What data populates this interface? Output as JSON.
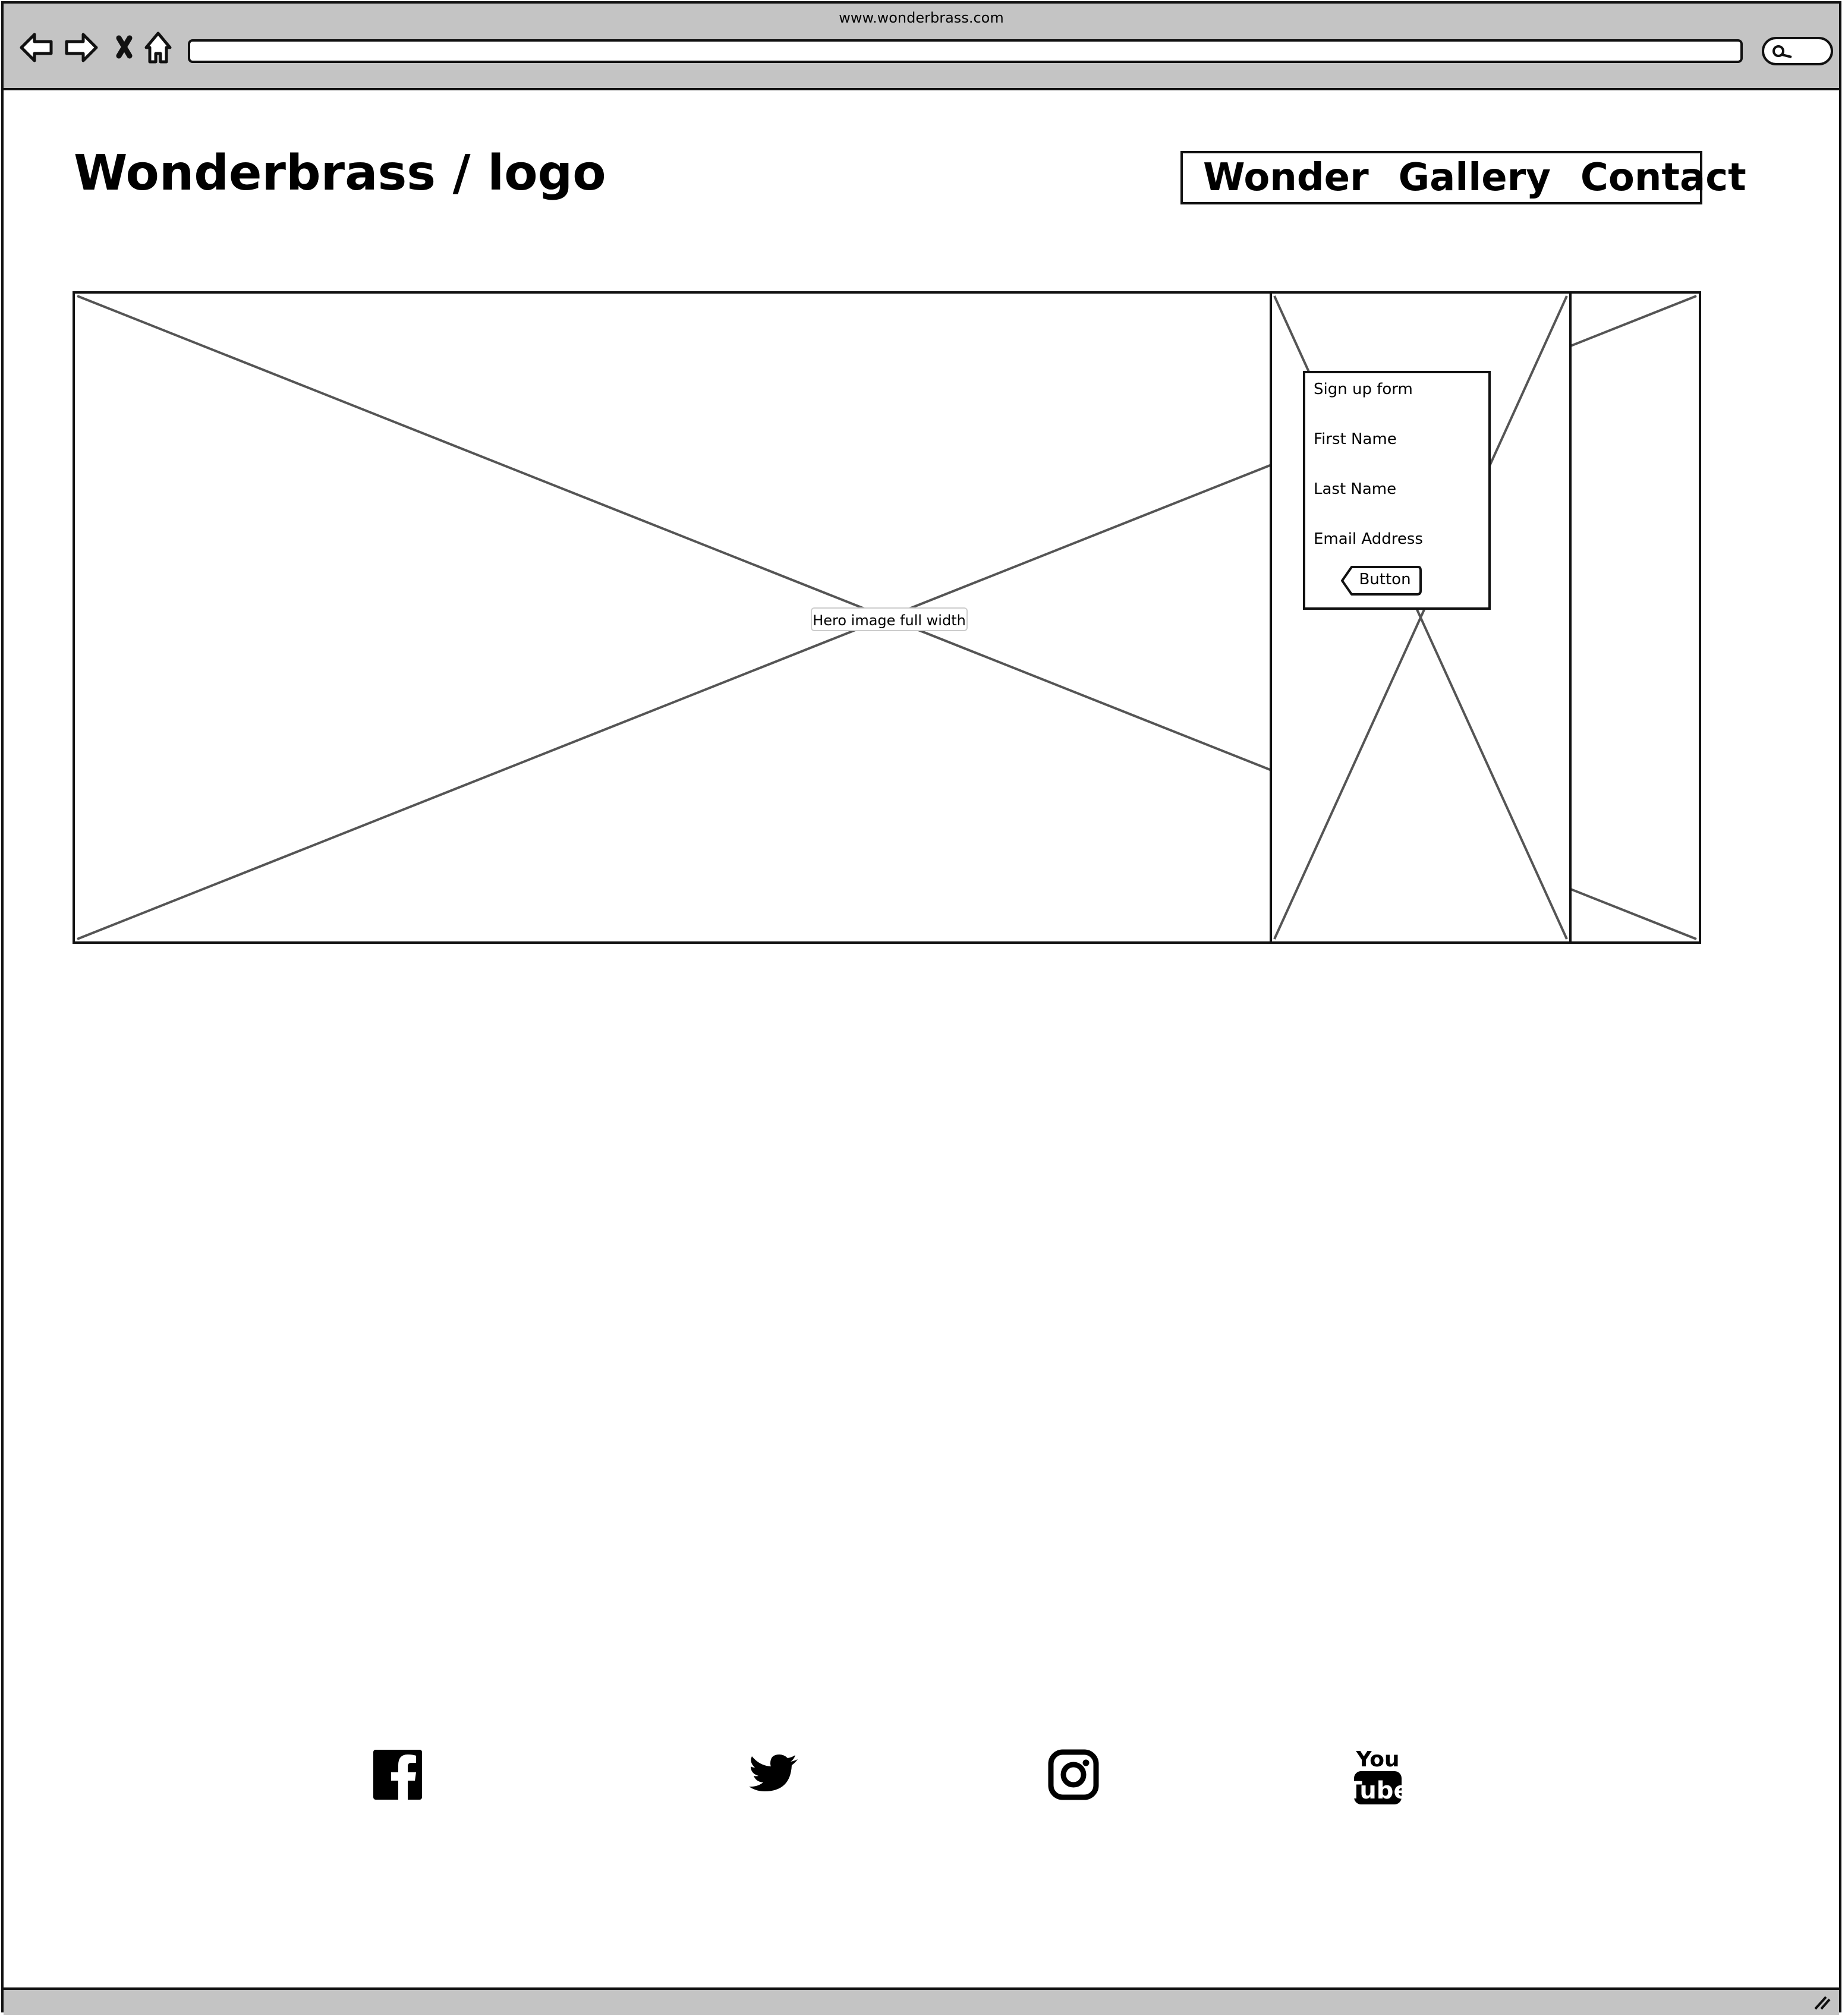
{
  "browser": {
    "url": "www.wonderbrass.com",
    "icons": [
      "back-arrow-icon",
      "forward-arrow-icon",
      "close-icon",
      "home-icon",
      "search-icon",
      "resize-grip-icon"
    ]
  },
  "header": {
    "logo_text": "Wonderbrass / logo",
    "nav": [
      "Wonder",
      "Gallery",
      "Contact"
    ]
  },
  "hero": {
    "label": "Hero image full width"
  },
  "signup_form": {
    "title": "Sign up form",
    "first_name": "First Name",
    "last_name": "Last Name",
    "email": "Email Address",
    "button": "Button"
  },
  "footer": {
    "social_icons": [
      "facebook-icon",
      "twitter-icon",
      "instagram-icon",
      "youtube-icon"
    ]
  }
}
